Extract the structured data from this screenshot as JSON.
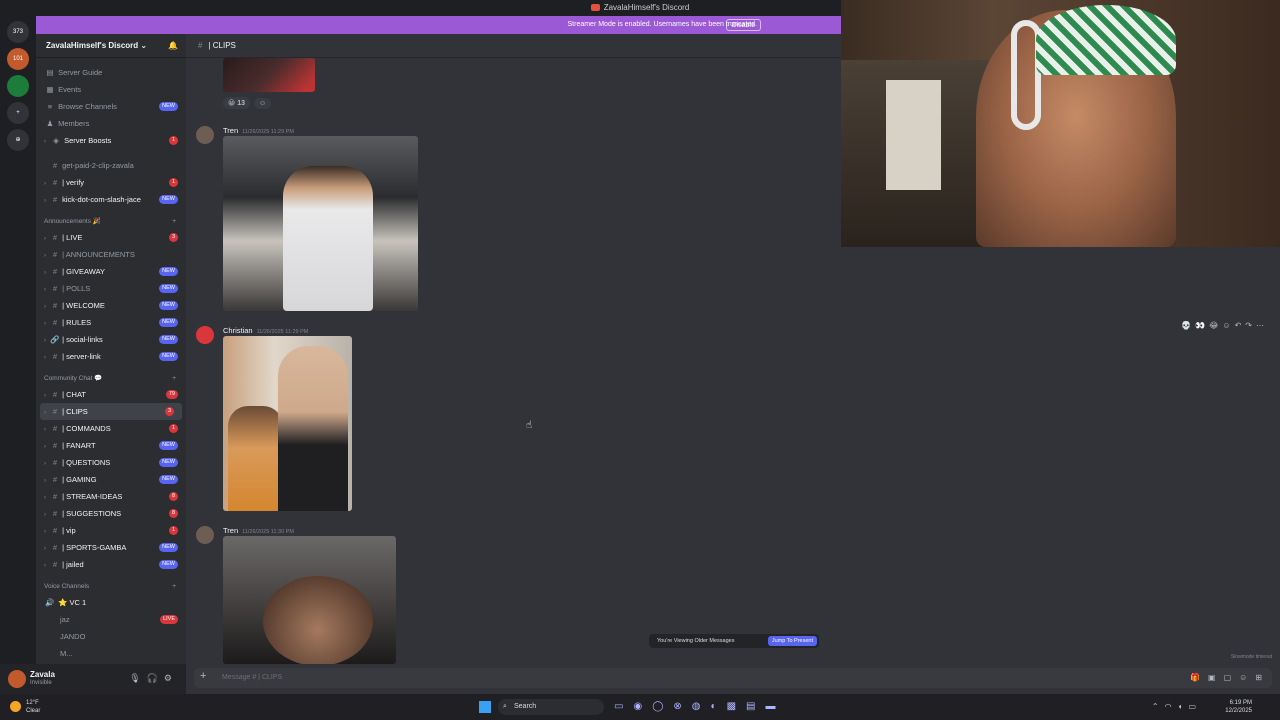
{
  "window": {
    "title": "ZavalaHimself's Discord"
  },
  "streamer_banner": {
    "text": "Streamer Mode is enabled. Usernames have been truncated.",
    "disable_label": "Disable",
    "color": "#9b59d6"
  },
  "server_rail": {
    "badges": [
      "373",
      "101"
    ]
  },
  "sidebar": {
    "server_name": "ZavalaHimself's Discord",
    "top_items": [
      {
        "label": "Server Guide"
      },
      {
        "label": "Events"
      },
      {
        "label": "Browse Channels",
        "badge": "NEW"
      },
      {
        "label": "Members"
      },
      {
        "label": "Server Boosts",
        "badge": "1"
      }
    ],
    "channels_a": [
      {
        "label": "get-paid-2-clip-zavala"
      },
      {
        "label": "| verify",
        "badge": "1"
      },
      {
        "label": "kick-dot-com-slash-jace",
        "badge": "NEW"
      }
    ],
    "cat_announcements": "Announcements",
    "channels_b": [
      {
        "label": "| LIVE",
        "badge": "3"
      },
      {
        "label": "| ANNOUNCEMENTS"
      },
      {
        "label": "| GIVEAWAY",
        "badge": "NEW"
      },
      {
        "label": "| POLLS",
        "badge": "NEW"
      },
      {
        "label": "| WELCOME",
        "badge": "NEW"
      },
      {
        "label": "| RULES",
        "badge": "NEW"
      },
      {
        "label": "| social-links",
        "badge": "NEW"
      },
      {
        "label": "| server-link",
        "badge": "NEW"
      }
    ],
    "cat_community": "Community Chat",
    "channels_c": [
      {
        "label": "| CHAT",
        "badge": "79"
      },
      {
        "label": "| CLIPS",
        "badge": "3"
      },
      {
        "label": "| COMMANDS",
        "badge": "1"
      },
      {
        "label": "| FANART",
        "badge": "NEW"
      },
      {
        "label": "| QUESTIONS",
        "badge": "NEW"
      },
      {
        "label": "| GAMING",
        "badge": "NEW"
      },
      {
        "label": "| STREAM-IDEAS",
        "badge": "8"
      },
      {
        "label": "| SUGGESTIONS",
        "badge": "8"
      },
      {
        "label": "| vip",
        "badge": "1"
      },
      {
        "label": "| SPORTS-GAMBA",
        "badge": "NEW"
      },
      {
        "label": "| jailed",
        "badge": "NEW"
      }
    ],
    "cat_voice": "Voice Channels",
    "voice": {
      "channel": "VC 1",
      "users": [
        "jaz",
        "JANDO",
        "M..."
      ],
      "live_label": "LIVE"
    }
  },
  "user": {
    "name": "Zavala",
    "status": "Invisible"
  },
  "channel": {
    "name": "| CLIPS",
    "input_placeholder": "Message #  | CLIPS"
  },
  "messages": [
    {
      "author": "Tren",
      "time": "11/26/2025 11:29 PM"
    },
    {
      "author": "Christian",
      "time": "11/26/2025 11:29 PM"
    },
    {
      "author": "Tren",
      "time": "11/26/2025 11:30 PM"
    }
  ],
  "reaction": {
    "count": "13"
  },
  "older_bar": {
    "text": "You're Viewing Older Messages",
    "jump_label": "Jump To Present"
  },
  "slowmode_text": "Slowmode timeout",
  "taskbar": {
    "temp": "12°F",
    "weather": "Clear",
    "search_label": "Search",
    "time": "6:19 PM",
    "date": "12/2/2025"
  }
}
